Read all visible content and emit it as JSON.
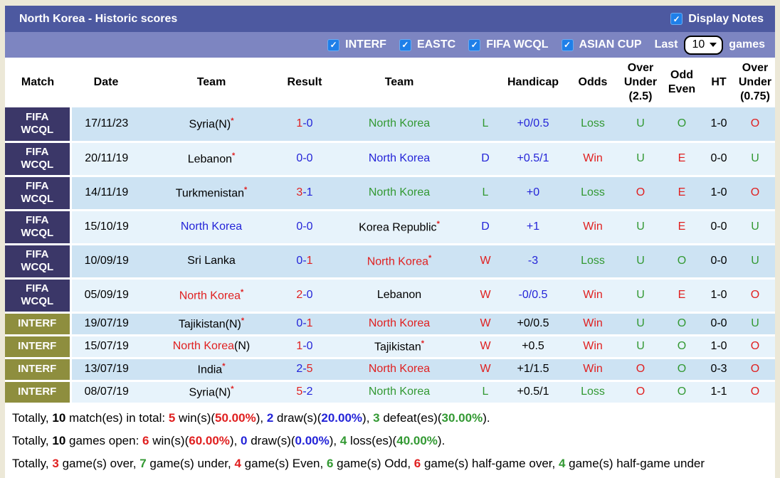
{
  "header": {
    "title": "North Korea - Historic scores",
    "display_notes_label": "Display Notes"
  },
  "filters": {
    "competitions": [
      "INTERF",
      "EASTC",
      "FIFA WCQL",
      "ASIAN CUP"
    ],
    "last_label": "Last",
    "last_value": "10",
    "games_label": "games"
  },
  "colors": {
    "title_bar": "#4d59a0",
    "filter_bar": "#7d85c1",
    "wcql_label_bg": "#3b3768",
    "interf_label_bg": "#8e8e3e",
    "row_dark": "#cde3f3",
    "row_light": "#e7f3fb",
    "checkbox_blue": "#1f7fe8",
    "win_red": "#e02020",
    "loss_green": "#339933",
    "draw_blue": "#2424d8"
  },
  "table": {
    "columns": [
      "Match",
      "Date",
      "Team",
      "Result",
      "Team",
      "",
      "Handicap",
      "Odds",
      "Over\nUnder\n(2.5)",
      "Odd\nEven",
      "HT",
      "Over\nUnder\n(0.75)"
    ],
    "rows": [
      {
        "league": "FIFA\nWCQL",
        "type": "wcql",
        "date": "17/11/23",
        "team1": {
          "name": "Syria(N)",
          "color": "black",
          "star": true
        },
        "result": {
          "home": "1",
          "away": "0",
          "home_color": "red",
          "away_color": "blue"
        },
        "team2": {
          "name": "North Korea",
          "color": "green",
          "star": false
        },
        "wdl": {
          "t": "L",
          "c": "green"
        },
        "handicap": {
          "t": "+0/0.5",
          "c": "blue"
        },
        "odds": {
          "t": "Loss",
          "c": "green"
        },
        "ou25": {
          "t": "U",
          "c": "green"
        },
        "oddeven": {
          "t": "O",
          "c": "green"
        },
        "ht": "1-0",
        "ou075": {
          "t": "O",
          "c": "red"
        }
      },
      {
        "league": "FIFA\nWCQL",
        "type": "wcql",
        "date": "20/11/19",
        "team1": {
          "name": "Lebanon",
          "color": "black",
          "star": true
        },
        "result": {
          "home": "0",
          "away": "0",
          "home_color": "blue",
          "away_color": "blue"
        },
        "team2": {
          "name": "North Korea",
          "color": "blue",
          "star": false
        },
        "wdl": {
          "t": "D",
          "c": "blue"
        },
        "handicap": {
          "t": "+0.5/1",
          "c": "blue"
        },
        "odds": {
          "t": "Win",
          "c": "red"
        },
        "ou25": {
          "t": "U",
          "c": "green"
        },
        "oddeven": {
          "t": "E",
          "c": "red"
        },
        "ht": "0-0",
        "ou075": {
          "t": "U",
          "c": "green"
        }
      },
      {
        "league": "FIFA\nWCQL",
        "type": "wcql",
        "date": "14/11/19",
        "team1": {
          "name": "Turkmenistan",
          "color": "black",
          "star": true
        },
        "result": {
          "home": "3",
          "away": "1",
          "home_color": "red",
          "away_color": "blue"
        },
        "team2": {
          "name": "North Korea",
          "color": "green",
          "star": false
        },
        "wdl": {
          "t": "L",
          "c": "green"
        },
        "handicap": {
          "t": "+0",
          "c": "blue"
        },
        "odds": {
          "t": "Loss",
          "c": "green"
        },
        "ou25": {
          "t": "O",
          "c": "red"
        },
        "oddeven": {
          "t": "E",
          "c": "red"
        },
        "ht": "1-0",
        "ou075": {
          "t": "O",
          "c": "red"
        }
      },
      {
        "league": "FIFA\nWCQL",
        "type": "wcql",
        "date": "15/10/19",
        "team1": {
          "name": "North Korea",
          "color": "blue",
          "star": false
        },
        "result": {
          "home": "0",
          "away": "0",
          "home_color": "blue",
          "away_color": "blue"
        },
        "team2": {
          "name": "Korea Republic",
          "color": "black",
          "star": true
        },
        "wdl": {
          "t": "D",
          "c": "blue"
        },
        "handicap": {
          "t": "+1",
          "c": "blue"
        },
        "odds": {
          "t": "Win",
          "c": "red"
        },
        "ou25": {
          "t": "U",
          "c": "green"
        },
        "oddeven": {
          "t": "E",
          "c": "red"
        },
        "ht": "0-0",
        "ou075": {
          "t": "U",
          "c": "green"
        }
      },
      {
        "league": "FIFA\nWCQL",
        "type": "wcql",
        "date": "10/09/19",
        "team1": {
          "name": "Sri Lanka",
          "color": "black",
          "star": false
        },
        "result": {
          "home": "0",
          "away": "1",
          "home_color": "blue",
          "away_color": "red"
        },
        "team2": {
          "name": "North Korea",
          "color": "red",
          "star": true
        },
        "wdl": {
          "t": "W",
          "c": "red"
        },
        "handicap": {
          "t": "-3",
          "c": "blue"
        },
        "odds": {
          "t": "Loss",
          "c": "green"
        },
        "ou25": {
          "t": "U",
          "c": "green"
        },
        "oddeven": {
          "t": "O",
          "c": "green"
        },
        "ht": "0-0",
        "ou075": {
          "t": "U",
          "c": "green"
        }
      },
      {
        "league": "FIFA\nWCQL",
        "type": "wcql",
        "date": "05/09/19",
        "team1": {
          "name": "North Korea",
          "color": "red",
          "star": true
        },
        "result": {
          "home": "2",
          "away": "0",
          "home_color": "red",
          "away_color": "blue"
        },
        "team2": {
          "name": "Lebanon",
          "color": "black",
          "star": false
        },
        "wdl": {
          "t": "W",
          "c": "red"
        },
        "handicap": {
          "t": "-0/0.5",
          "c": "blue"
        },
        "odds": {
          "t": "Win",
          "c": "red"
        },
        "ou25": {
          "t": "U",
          "c": "green"
        },
        "oddeven": {
          "t": "E",
          "c": "red"
        },
        "ht": "1-0",
        "ou075": {
          "t": "O",
          "c": "red"
        }
      },
      {
        "league": "INTERF",
        "type": "interf",
        "date": "19/07/19",
        "team1": {
          "name": "Tajikistan(N)",
          "color": "black",
          "star": true
        },
        "result": {
          "home": "0",
          "away": "1",
          "home_color": "blue",
          "away_color": "red"
        },
        "team2": {
          "name": "North Korea",
          "color": "red",
          "star": false
        },
        "wdl": {
          "t": "W",
          "c": "red"
        },
        "handicap": {
          "t": "+0/0.5",
          "c": "black"
        },
        "odds": {
          "t": "Win",
          "c": "red"
        },
        "ou25": {
          "t": "U",
          "c": "green"
        },
        "oddeven": {
          "t": "O",
          "c": "green"
        },
        "ht": "0-0",
        "ou075": {
          "t": "U",
          "c": "green"
        }
      },
      {
        "league": "INTERF",
        "type": "interf",
        "date": "15/07/19",
        "team1": {
          "name": "North Korea",
          "suffix": "(N)",
          "color": "red",
          "star": false
        },
        "result": {
          "home": "1",
          "away": "0",
          "home_color": "red",
          "away_color": "blue"
        },
        "team2": {
          "name": "Tajikistan",
          "color": "black",
          "star": true
        },
        "wdl": {
          "t": "W",
          "c": "red"
        },
        "handicap": {
          "t": "+0.5",
          "c": "black"
        },
        "odds": {
          "t": "Win",
          "c": "red"
        },
        "ou25": {
          "t": "U",
          "c": "green"
        },
        "oddeven": {
          "t": "O",
          "c": "green"
        },
        "ht": "1-0",
        "ou075": {
          "t": "O",
          "c": "red"
        }
      },
      {
        "league": "INTERF",
        "type": "interf",
        "date": "13/07/19",
        "team1": {
          "name": "India",
          "color": "black",
          "star": true
        },
        "result": {
          "home": "2",
          "away": "5",
          "home_color": "blue",
          "away_color": "red"
        },
        "team2": {
          "name": "North Korea",
          "color": "red",
          "star": false
        },
        "wdl": {
          "t": "W",
          "c": "red"
        },
        "handicap": {
          "t": "+1/1.5",
          "c": "black"
        },
        "odds": {
          "t": "Win",
          "c": "red"
        },
        "ou25": {
          "t": "O",
          "c": "red"
        },
        "oddeven": {
          "t": "O",
          "c": "green"
        },
        "ht": "0-3",
        "ou075": {
          "t": "O",
          "c": "red"
        }
      },
      {
        "league": "INTERF",
        "type": "interf",
        "date": "08/07/19",
        "team1": {
          "name": "Syria(N)",
          "color": "black",
          "star": true
        },
        "result": {
          "home": "5",
          "away": "2",
          "home_color": "red",
          "away_color": "blue"
        },
        "team2": {
          "name": "North Korea",
          "color": "green",
          "star": false
        },
        "wdl": {
          "t": "L",
          "c": "green"
        },
        "handicap": {
          "t": "+0.5/1",
          "c": "black"
        },
        "odds": {
          "t": "Loss",
          "c": "green"
        },
        "ou25": {
          "t": "O",
          "c": "red"
        },
        "oddeven": {
          "t": "O",
          "c": "green"
        },
        "ht": "1-1",
        "ou075": {
          "t": "O",
          "c": "red"
        }
      }
    ]
  },
  "summary_lines": [
    [
      {
        "t": "Totally, "
      },
      {
        "t": "10",
        "b": true
      },
      {
        "t": " match(es) in total: "
      },
      {
        "t": "5",
        "b": true,
        "c": "red"
      },
      {
        "t": " win(s)("
      },
      {
        "t": "50.00%",
        "b": true,
        "c": "red"
      },
      {
        "t": "), "
      },
      {
        "t": "2",
        "b": true,
        "c": "blue"
      },
      {
        "t": " draw(s)("
      },
      {
        "t": "20.00%",
        "b": true,
        "c": "blue"
      },
      {
        "t": "), "
      },
      {
        "t": "3",
        "b": true,
        "c": "green"
      },
      {
        "t": " defeat(es)("
      },
      {
        "t": "30.00%",
        "b": true,
        "c": "green"
      },
      {
        "t": ")."
      }
    ],
    [
      {
        "t": "Totally, "
      },
      {
        "t": "10",
        "b": true
      },
      {
        "t": " games open: "
      },
      {
        "t": "6",
        "b": true,
        "c": "red"
      },
      {
        "t": " win(s)("
      },
      {
        "t": "60.00%",
        "b": true,
        "c": "red"
      },
      {
        "t": "), "
      },
      {
        "t": "0",
        "b": true,
        "c": "blue"
      },
      {
        "t": " draw(s)("
      },
      {
        "t": "0.00%",
        "b": true,
        "c": "blue"
      },
      {
        "t": "), "
      },
      {
        "t": "4",
        "b": true,
        "c": "green"
      },
      {
        "t": " loss(es)("
      },
      {
        "t": "40.00%",
        "b": true,
        "c": "green"
      },
      {
        "t": ")."
      }
    ],
    [
      {
        "t": "Totally, "
      },
      {
        "t": "3",
        "b": true,
        "c": "red"
      },
      {
        "t": " game(s) over, "
      },
      {
        "t": "7",
        "b": true,
        "c": "green"
      },
      {
        "t": " game(s) under, "
      },
      {
        "t": "4",
        "b": true,
        "c": "red"
      },
      {
        "t": " game(s) Even, "
      },
      {
        "t": "6",
        "b": true,
        "c": "green"
      },
      {
        "t": " game(s) Odd, "
      },
      {
        "t": "6",
        "b": true,
        "c": "red"
      },
      {
        "t": " game(s) half-game over, "
      },
      {
        "t": "4",
        "b": true,
        "c": "green"
      },
      {
        "t": " game(s) half-game under"
      }
    ]
  ]
}
